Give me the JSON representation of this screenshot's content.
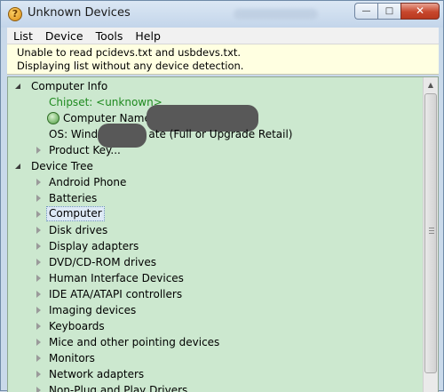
{
  "window": {
    "title": "Unknown Devices",
    "controls": {
      "minimize": "—",
      "maximize": "□",
      "close": "✕"
    }
  },
  "menu": [
    "List",
    "Device",
    "Tools",
    "Help"
  ],
  "info": {
    "line1": "Unable to read pcidevs.txt and usbdevs.txt.",
    "line2": "Displaying list without any device detection."
  },
  "tree": {
    "computer_info": {
      "label": "Computer Info",
      "chipset": "Chipset: <unknown>",
      "computer_name_label": "Computer Name:",
      "os_prefix": "OS: Windo",
      "os_suffix": "ate  (Full or Upgrade Retail)",
      "product_key": "Product Key..."
    },
    "device_tree": {
      "label": "Device Tree",
      "items": [
        "Android Phone",
        "Batteries",
        "Computer",
        "Disk drives",
        "Display adapters",
        "DVD/CD-ROM drives",
        "Human Interface Devices",
        "IDE ATA/ATAPI controllers",
        "Imaging devices",
        "Keyboards",
        "Mice and other pointing devices",
        "Monitors",
        "Network adapters",
        "Non-Plug and Play Drivers"
      ],
      "selected": "Computer"
    }
  },
  "colors": {
    "tree_bg": "#cce8cf",
    "info_bg": "#ffffe1",
    "chipset_text": "#1f8a1f"
  }
}
